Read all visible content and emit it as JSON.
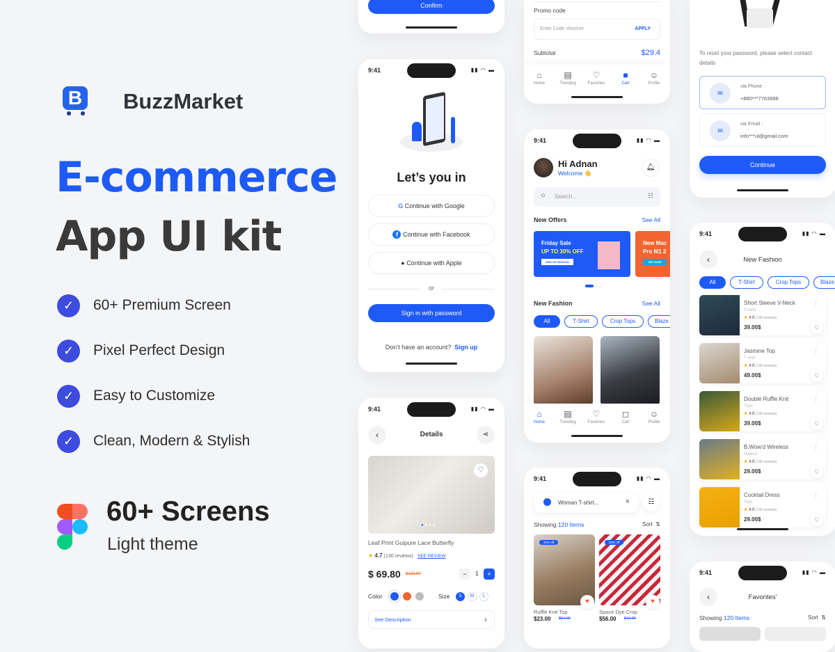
{
  "brand": {
    "name": "BuzzMarket",
    "logo_letter": "B"
  },
  "hero": {
    "title_line1": "E-commerce",
    "title_line2": "App UI kit",
    "accent": "#1e5af5"
  },
  "features": [
    "60+  Premium Screen",
    "Pixel Perfect Design",
    "Easy to Customize",
    "Clean, Modern & Stylish"
  ],
  "screens_info": {
    "count": "60+ Screens",
    "theme": "Light theme"
  },
  "status": {
    "time": "9:41"
  },
  "confirm_screen": {
    "button": "Confirm"
  },
  "login": {
    "title": "Let’s you in",
    "google": "Continue with Google",
    "facebook": "Continue with Facebook",
    "apple": "Continue with Apple",
    "or": "or",
    "password_button": "Sign in with password",
    "no_account": "Don’t have an account?",
    "signup": "Sign up"
  },
  "cart": {
    "promo_label": "Promo code",
    "promo_placeholder": "Enter Code Voucher",
    "apply": "APPLY",
    "subtotal_label": "Subtotal",
    "subtotal_value": "$29.4"
  },
  "nav": [
    "Home",
    "Trending",
    "Favorites",
    "Cart",
    "Profile"
  ],
  "home": {
    "greeting": "Hi Adnan",
    "welcome": "Welcome 👋",
    "search_placeholder": "Search...",
    "offers_title": "New Offers",
    "see_all": "See All",
    "banner1": {
      "line1": "Friday Sale",
      "line2": "UP TO 30% OFF",
      "tag": "END OF SEASON"
    },
    "banner2": {
      "line1": "New Mac",
      "line2": "Pro M1 2",
      "tag": "GET NOW"
    },
    "fashion_title": "New Fashion"
  },
  "chips": [
    "All",
    "T-Shirt",
    "Crop Tops",
    "Blaze"
  ],
  "details": {
    "title": "Details",
    "product": "Leaf Print Guipure Lace  Butterfly",
    "rating": "4.7",
    "reviews": "(130 reviews)",
    "see_review": "SEE REVIEW",
    "price": "$ 69.80",
    "old_price": "$122.00",
    "qty": "1",
    "color_label": "Color",
    "size_label": "Size",
    "sizes": [
      "S",
      "M",
      "L"
    ],
    "colors": [
      "#1e5af5",
      "#f26430",
      "#bdbdbd"
    ],
    "description": "See Description"
  },
  "search": {
    "query": "Woman T-shirt...",
    "showing": "Showing",
    "count": "120 Items",
    "sort": "Sort",
    "items": [
      {
        "badge": "20% off",
        "name": "Ruffle Knit Top",
        "price": "$23.00",
        "old": "$54.00"
      },
      {
        "badge": "20% off",
        "name": "Space Dye Crop",
        "price": "$56.00",
        "old": "$42.00"
      }
    ]
  },
  "reset": {
    "instruction": "To reset your password, please select contact details",
    "phone_label": "via Phone :",
    "phone_value": "+880***7763666",
    "email_label": "via Email :",
    "email_value": "info***ul@gmail.com",
    "button": "Continue"
  },
  "fashion_list": {
    "title": "New Fashion",
    "items": [
      {
        "name": "Short Sleeve V-Neck",
        "cat": "Coarts",
        "rating": "4.8",
        "reviews": "(130 reviews)",
        "price": "39.00$"
      },
      {
        "name": "Jasmine Top",
        "cat": "T-shirt",
        "rating": "4.8",
        "reviews": "(130 reviews)",
        "price": "49.00$"
      },
      {
        "name": "Double Ruffle Knit",
        "cat": "Tops",
        "rating": "4.8",
        "reviews": "(130 reviews)",
        "price": "39.00$"
      },
      {
        "name": "B.Wow'd Wireless",
        "cat": "Hodeui",
        "rating": "4.8",
        "reviews": "(130 reviews)",
        "price": "29.00$"
      },
      {
        "name": "Cocktail Dress",
        "cat": "Tops",
        "rating": "4.8",
        "reviews": "(130 reviews)",
        "price": "29.00$"
      }
    ]
  },
  "favorites": {
    "title": "Favorites'",
    "showing": "Showing",
    "count": "120 Items",
    "sort": "Sort"
  }
}
